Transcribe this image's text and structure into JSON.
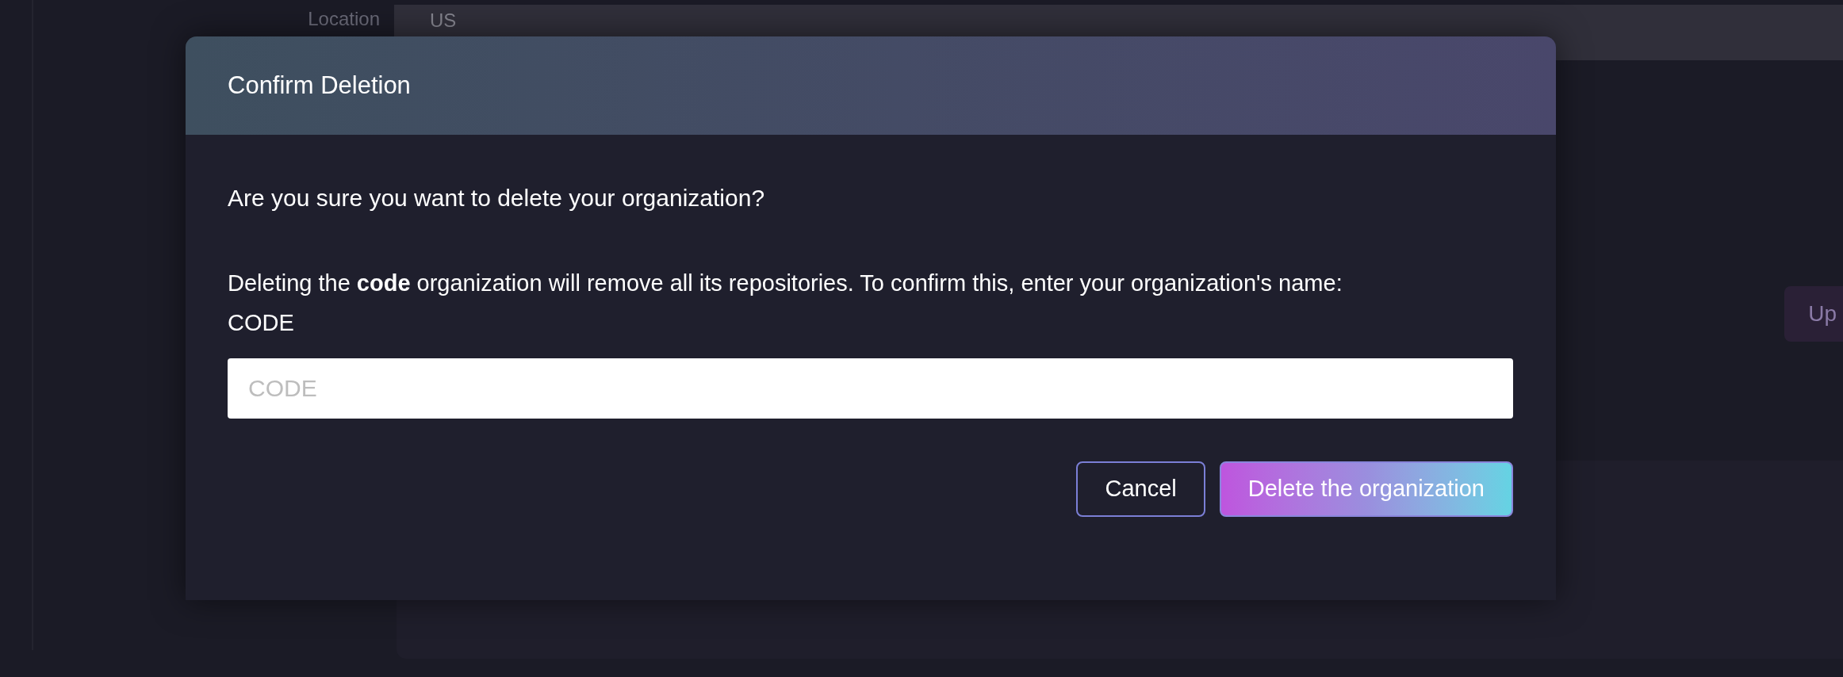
{
  "background": {
    "location_label": "Location",
    "location_value": "US",
    "button_label": "Up"
  },
  "dialog": {
    "title": "Confirm Deletion",
    "question": "Are you sure you want to delete your organization?",
    "instruction": "Deleting the **code** organization will remove all its repositories. To confirm this, enter your organization's name: CODE",
    "input": {
      "placeholder": "CODE"
    },
    "buttons": [
      {
        "label": "Cancel",
        "kind": "secondary"
      },
      {
        "label": "Delete the organization",
        "kind": "primary"
      }
    ]
  }
}
